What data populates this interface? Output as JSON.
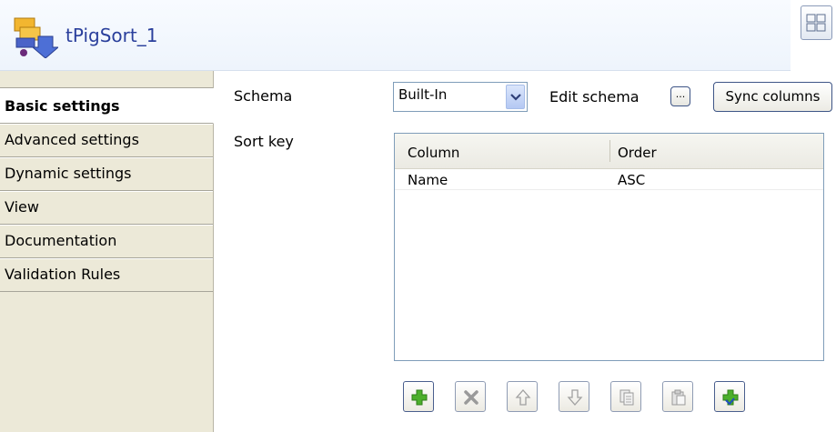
{
  "header": {
    "title": "tPigSort_1"
  },
  "sidebar": {
    "tabs": [
      {
        "label": "Basic settings"
      },
      {
        "label": "Advanced settings"
      },
      {
        "label": "Dynamic settings"
      },
      {
        "label": "View"
      },
      {
        "label": "Documentation"
      },
      {
        "label": "Validation Rules"
      }
    ]
  },
  "form": {
    "schema_label": "Schema",
    "schema_value": "Built-In",
    "edit_schema_label": "Edit schema",
    "ellipsis_label": "...",
    "sync_columns_label": "Sync columns",
    "sort_key_label": "Sort key"
  },
  "table": {
    "columns": [
      "Column",
      "Order"
    ],
    "rows": [
      [
        "Name",
        "ASC"
      ]
    ]
  },
  "toolbar": {
    "buttons": [
      "add-icon",
      "delete-icon",
      "move-up-icon",
      "move-down-icon",
      "copy-icon",
      "paste-icon",
      "add-column-icon"
    ]
  },
  "colors": {
    "title": "#2a3f9c",
    "add_green": "#3a9a1e",
    "sidebar_bg": "#ece9d8"
  }
}
